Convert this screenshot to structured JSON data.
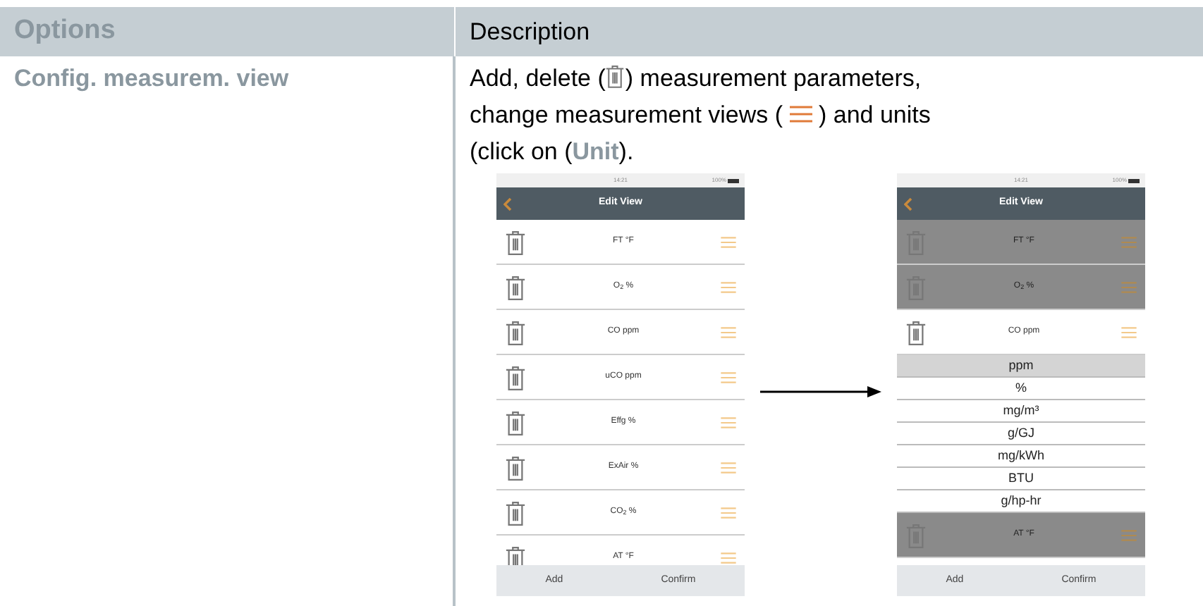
{
  "table": {
    "columns": [
      "Options",
      "Description"
    ],
    "rows": [
      {
        "option": "Config. measurem. view",
        "description": [
          [
            {
              "kind": "text",
              "text": "Add, delete ("
            },
            {
              "kind": "trash"
            },
            {
              "kind": "text",
              "text": ") measurement parameters,"
            }
          ],
          [
            {
              "kind": "text",
              "text": "change measurement views ( "
            },
            {
              "kind": "handle"
            },
            {
              "kind": "text",
              "text": " ) and units"
            }
          ],
          [
            {
              "kind": "text",
              "text": "(click on (**Unit**)."
            }
          ]
        ]
      }
    ]
  },
  "screens": [
    {
      "time": "14:21",
      "battery": "100%",
      "title": "Edit View",
      "rows": [
        {
          "label": "FT °F"
        },
        {
          "label": "O$_{2}$ %"
        },
        {
          "label": "CO ppm"
        },
        {
          "label": "uCO ppm"
        },
        {
          "label": "Effg %"
        },
        {
          "label": "ExAir %"
        },
        {
          "label": "CO$_{2}$ %"
        },
        {
          "label": "AT °F"
        }
      ],
      "buttons": [
        "Add",
        "Confirm"
      ]
    },
    {
      "time": "14:21",
      "battery": "100%",
      "title": "Edit View",
      "rows": [
        {
          "label": "FT °F",
          "dimmed": true
        },
        {
          "label": "O$_{2}$ %",
          "dimmed": true
        },
        {
          "label": "CO ppm",
          "dimmed": false
        },
        {
          "label": "AT °F",
          "dimmed": true
        }
      ],
      "unit_picker": [
        {
          "label": "ppm",
          "selected": true
        },
        {
          "label": "%",
          "selected": false
        },
        {
          "label": "mg/m³",
          "selected": false
        },
        {
          "label": "g/GJ",
          "selected": false
        },
        {
          "label": "mg/kWh",
          "selected": false
        },
        {
          "label": "BTU",
          "selected": false
        },
        {
          "label": "g/hp-hr",
          "selected": false
        }
      ],
      "buttons": [
        "Add",
        "Confirm"
      ]
    }
  ]
}
